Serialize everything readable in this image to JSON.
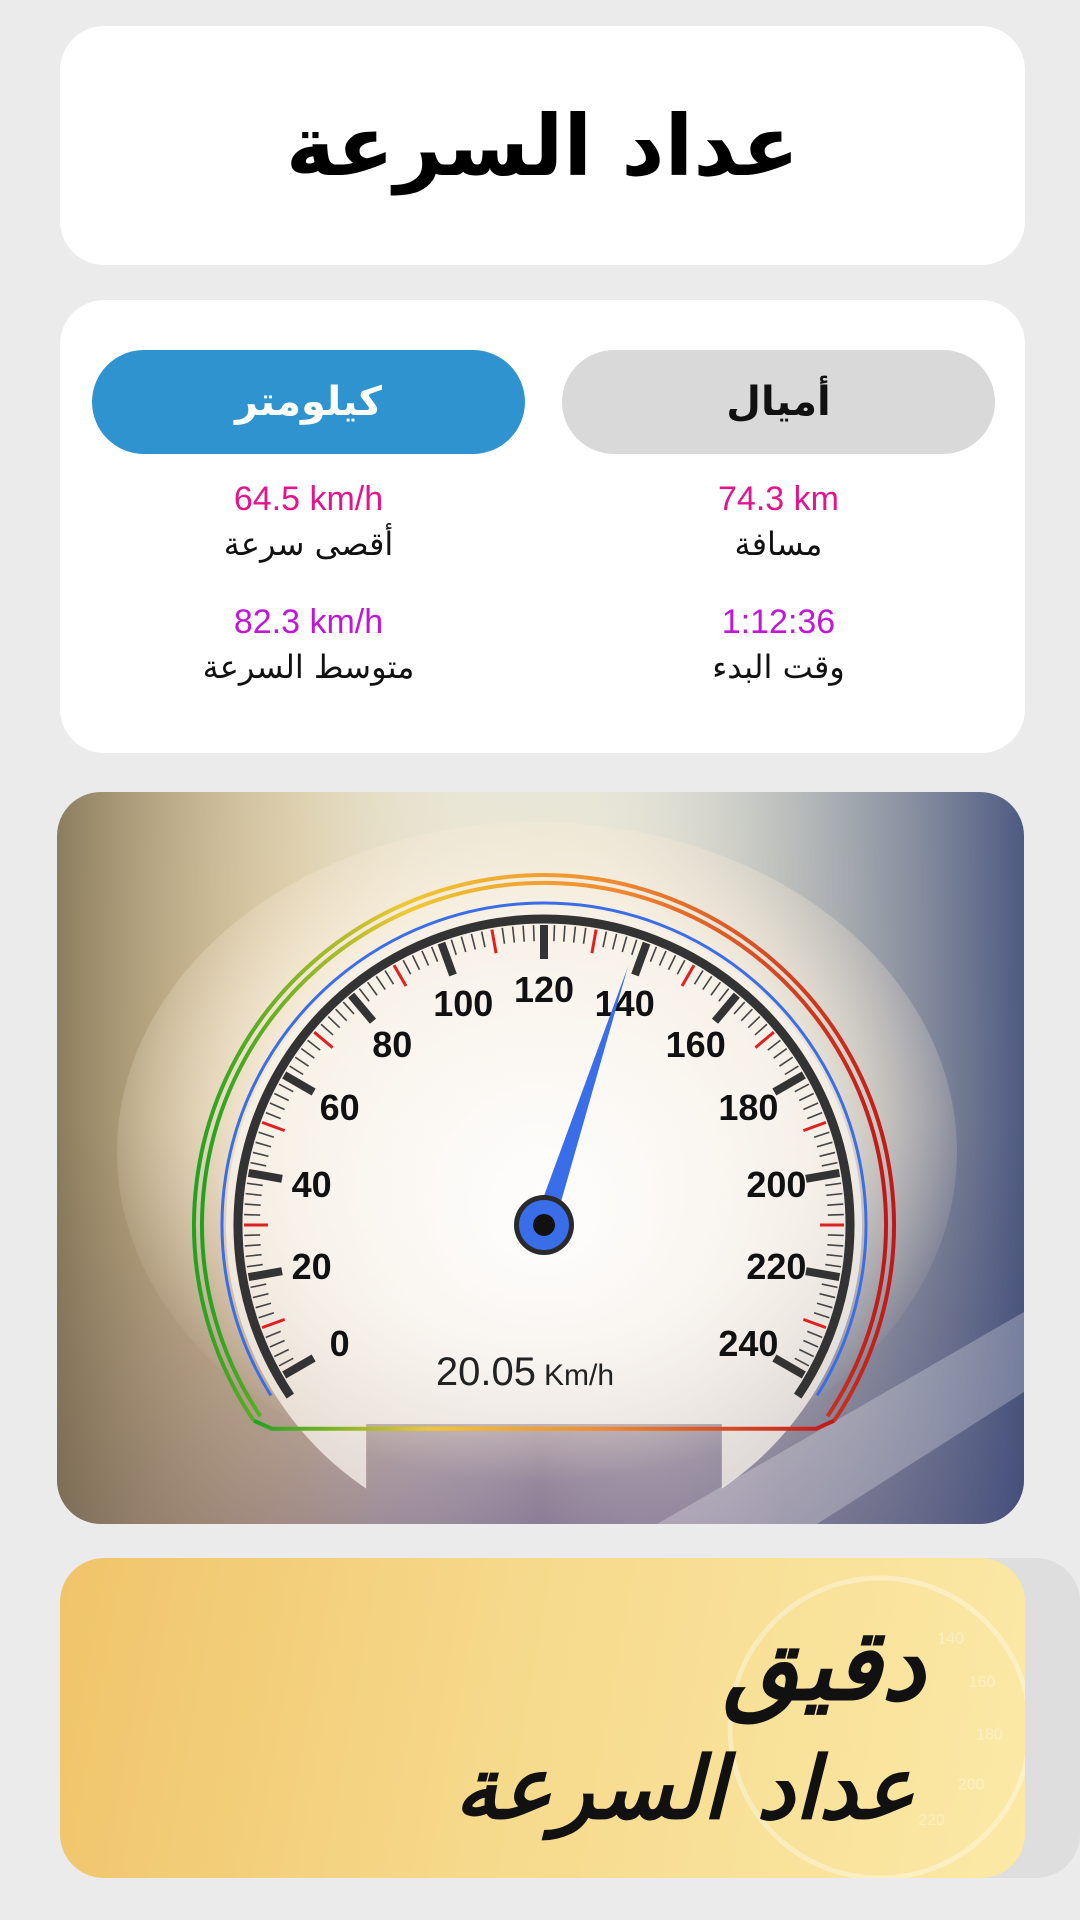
{
  "header": {
    "title": "عداد السرعة"
  },
  "units": {
    "km_label": "كيلومتر",
    "miles_label": "أميال",
    "selected": "km"
  },
  "stats": {
    "max_speed": {
      "value": "64.5 km/h",
      "label": "أقصى سرعة",
      "color": "#e3148c"
    },
    "distance": {
      "value": "74.3 km",
      "label": "مسافة",
      "color": "#e3148c"
    },
    "avg_speed": {
      "value": "82.3 km/h",
      "label": "متوسط السرعة",
      "color": "#c116d8"
    },
    "start_time": {
      "value": "1:12:36",
      "label": "وقت البدء",
      "color": "#c116d8"
    }
  },
  "gauge": {
    "labels": [
      "0",
      "20",
      "40",
      "60",
      "80",
      "100",
      "120",
      "140",
      "160",
      "180",
      "200",
      "220",
      "240"
    ],
    "max": 240,
    "needle_value": 138,
    "speed_value": "20.05",
    "speed_unit": "Km/h",
    "needle_color": "#3a6ee8"
  },
  "banner": {
    "line1": "دقيق",
    "line2": "عداد السرعة",
    "dial_labels": [
      "140",
      "160",
      "180",
      "200",
      "220"
    ]
  }
}
